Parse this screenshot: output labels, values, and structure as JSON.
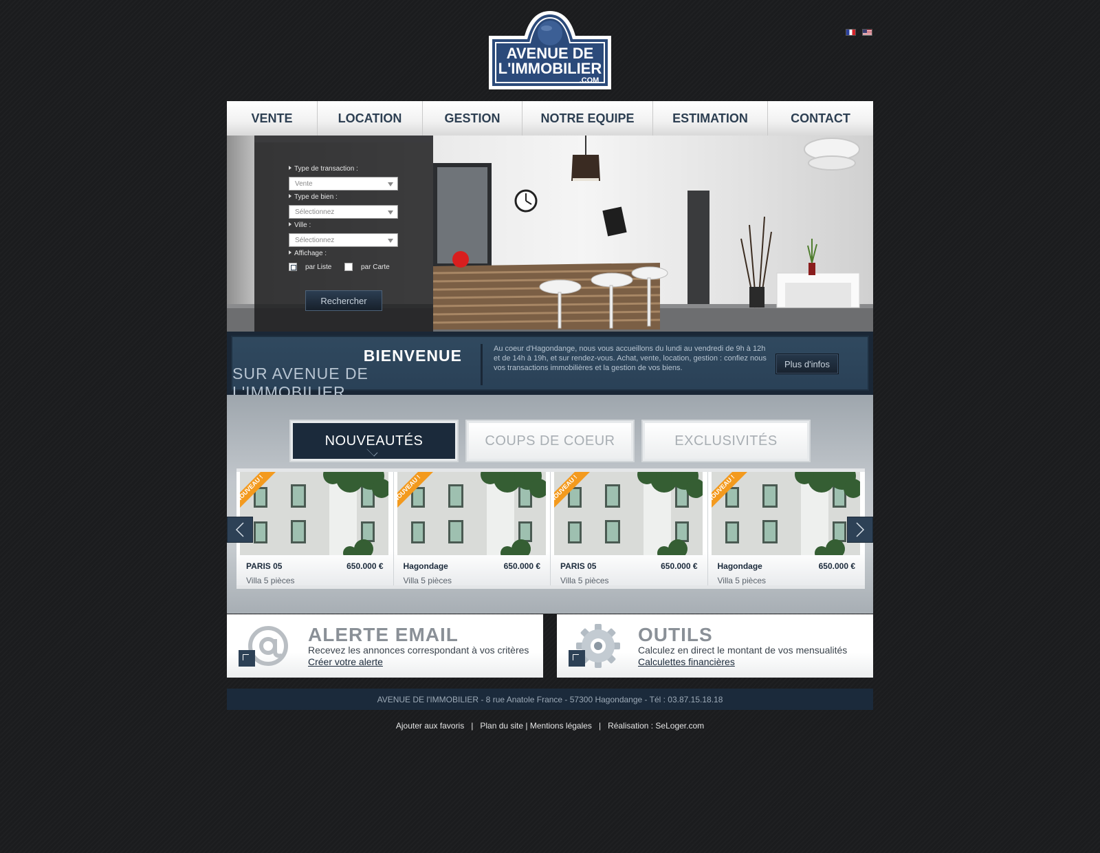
{
  "logo": {
    "line1": "AVENUE DE",
    "line2": "L'IMMOBILIER",
    "line3": ".COM"
  },
  "languages": [
    {
      "code": "fr",
      "icon": "flag-fr-icon"
    },
    {
      "code": "en",
      "icon": "flag-us-icon"
    }
  ],
  "nav": {
    "items": [
      "VENTE",
      "LOCATION",
      "GESTION",
      "NOTRE EQUIPE",
      "ESTIMATION",
      "CONTACT"
    ]
  },
  "search": {
    "transaction_label": "Type de transaction :",
    "transaction_value": "Vente",
    "property_label": "Type de bien :",
    "property_value": "Sélectionnez",
    "city_label": "Ville :",
    "city_value": "Sélectionnez",
    "display_label": "Affichage :",
    "display_list_label": "par Liste",
    "display_map_label": "par Carte",
    "display_list_checked": true,
    "display_map_checked": false,
    "submit_label": "Rechercher"
  },
  "welcome": {
    "title_line1": "BIENVENUE",
    "title_line2": "SUR AVENUE DE L'IMMOBILIER",
    "text": "Au coeur d'Hagondange, nous vous accueillons du lundi au vendredi de 9h à 12h et de 14h à 19h, et sur rendez-vous. Achat, vente, location, gestion : confiez nous vos transactions immobilières et la gestion de vos biens.",
    "more_label": "Plus d'infos"
  },
  "tabs": [
    {
      "label": "NOUVEAUTÉS",
      "active": true
    },
    {
      "label": "COUPS DE COEUR",
      "active": false
    },
    {
      "label": "EXCLUSIVITÉS",
      "active": false
    }
  ],
  "listings": [
    {
      "badge": "NOUVEAU !",
      "city": "PARIS 05",
      "price": "650.000 €",
      "type": "Villa 5 pièces"
    },
    {
      "badge": "NOUVEAU !",
      "city": "Hagondage",
      "price": "650.000 €",
      "type": "Villa 5 pièces"
    },
    {
      "badge": "NOUVEAU !",
      "city": "PARIS 05",
      "price": "650.000 €",
      "type": "Villa 5 pièces"
    },
    {
      "badge": "NOUVEAU !",
      "city": "Hagondage",
      "price": "650.000 €",
      "type": "Villa 5 pièces"
    }
  ],
  "alert": {
    "title": "ALERTE EMAIL",
    "text": "Recevez les annonces correspondant à vos critères",
    "link": "Créer votre alerte",
    "icon": "at-sign-icon"
  },
  "tools": {
    "title": "OUTILS",
    "text": "Calculez en direct le montant de vos mensualités",
    "link": "Calculettes financières",
    "icon": "gear-icon"
  },
  "footer": {
    "address": "AVENUE DE l'IMMOBILIER - 8 rue Anatole France - 57300 Hagondange - Tél : 03.87.15.18.18",
    "favorites": "Ajouter aux favoris",
    "sitemap": "Plan du site",
    "legal": "Mentions légales",
    "credits": "Réalisation : SeLoger.com"
  },
  "colors": {
    "brand_navy": "#1b2a3b",
    "brand_blue": "#2d4156",
    "background": "#1b1c1e",
    "badge_orange": "#f39a1e"
  }
}
